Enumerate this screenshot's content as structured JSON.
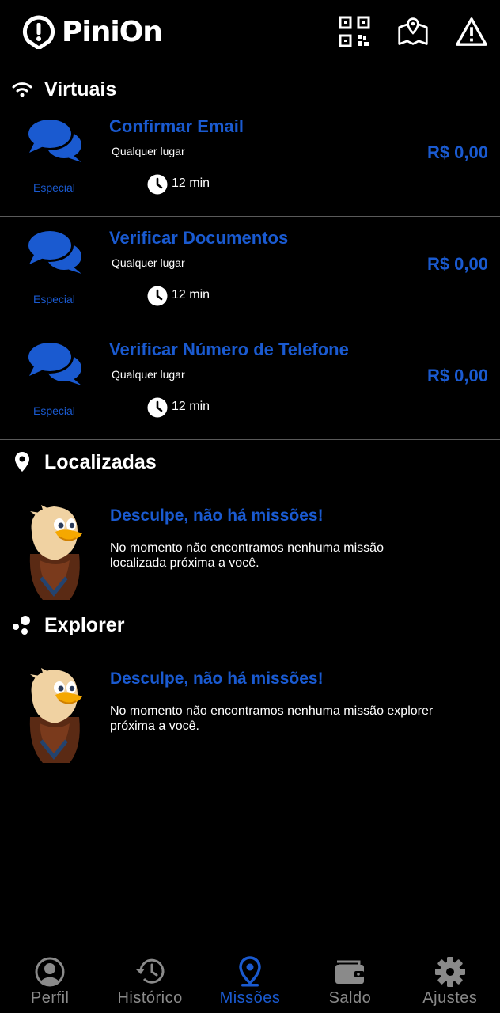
{
  "app": {
    "name": "PiniOn"
  },
  "sections": {
    "virtuais": {
      "title": "Virtuais"
    },
    "localizadas": {
      "title": "Localizadas",
      "empty_title": "Desculpe, não há missões!",
      "empty_text": "No momento não encontramos nenhuma missão localizada próxima a você."
    },
    "explorer": {
      "title": "Explorer",
      "empty_title": "Desculpe, não há missões!",
      "empty_text": "No momento não encontramos nenhuma missão explorer próxima a você."
    }
  },
  "missions": [
    {
      "title": "Confirmar Email",
      "location": "Qualquer lugar",
      "tag": "Especial",
      "time": "12 min",
      "price": "R$ 0,00"
    },
    {
      "title": "Verificar Documentos",
      "location": "Qualquer lugar",
      "tag": "Especial",
      "time": "12 min",
      "price": "R$ 0,00"
    },
    {
      "title": "Verificar Número de Telefone",
      "location": "Qualquer lugar",
      "tag": "Especial",
      "time": "12 min",
      "price": "R$ 0,00"
    }
  ],
  "nav": [
    {
      "label": "Perfil",
      "icon": "user-circle-icon"
    },
    {
      "label": "Histórico",
      "icon": "history-icon"
    },
    {
      "label": "Missões",
      "icon": "location-pin-icon",
      "active": true
    },
    {
      "label": "Saldo",
      "icon": "wallet-icon"
    },
    {
      "label": "Ajustes",
      "icon": "gear-icon"
    }
  ],
  "colors": {
    "accent": "#1a5ad0",
    "background": "#000000",
    "divider": "#5a5a5a",
    "inactive": "#8a8a8a"
  }
}
